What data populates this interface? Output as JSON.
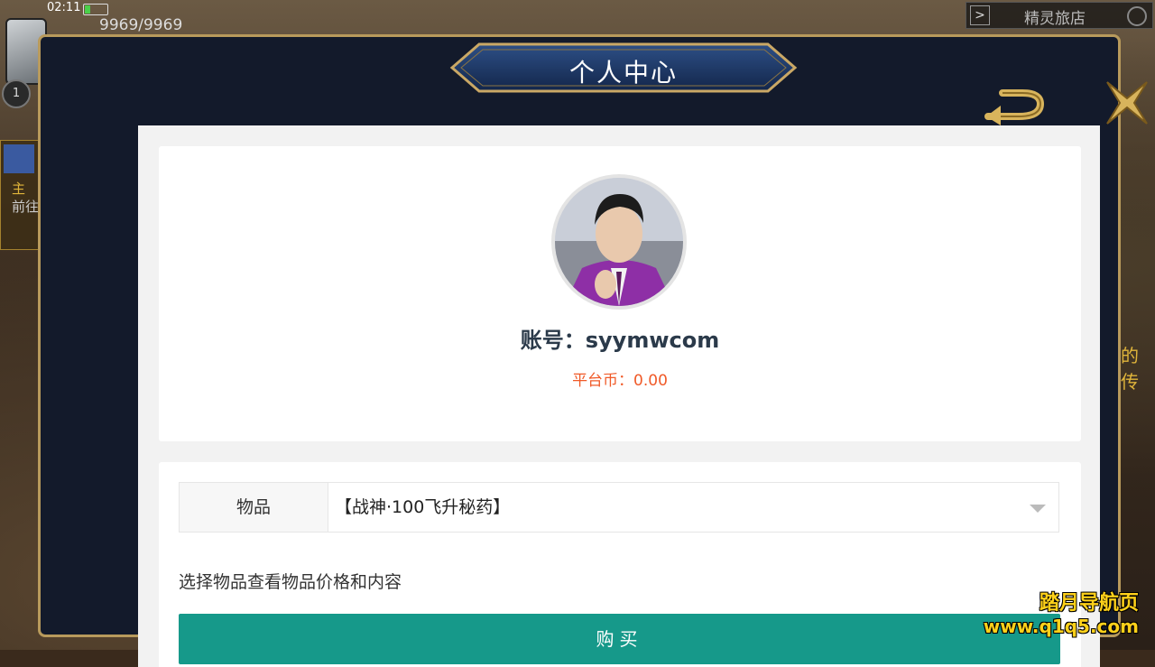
{
  "hud": {
    "time": "02:11",
    "energy": "9969/9969",
    "level": "1",
    "quest_line1": "主",
    "quest_line2": "前往"
  },
  "shop": {
    "label": "精灵旅店"
  },
  "side_text": "的传",
  "modal": {
    "title": "个人中心"
  },
  "profile": {
    "account": "账号：syymwcom",
    "coins": "平台币：0.00"
  },
  "purchase": {
    "item_label": "物品",
    "item_value": "【战神·100飞升秘药】",
    "hint": "选择物品查看物品价格和内容",
    "buy_label": "购买"
  },
  "watermark": {
    "line1": "踏月导航页",
    "line2": "www.q1q5.com"
  },
  "colors": {
    "buy_button": "#16998a",
    "coins_text": "#f05a28",
    "modal_bg": "#131a2b",
    "gold_trim": "#b89a5c"
  }
}
